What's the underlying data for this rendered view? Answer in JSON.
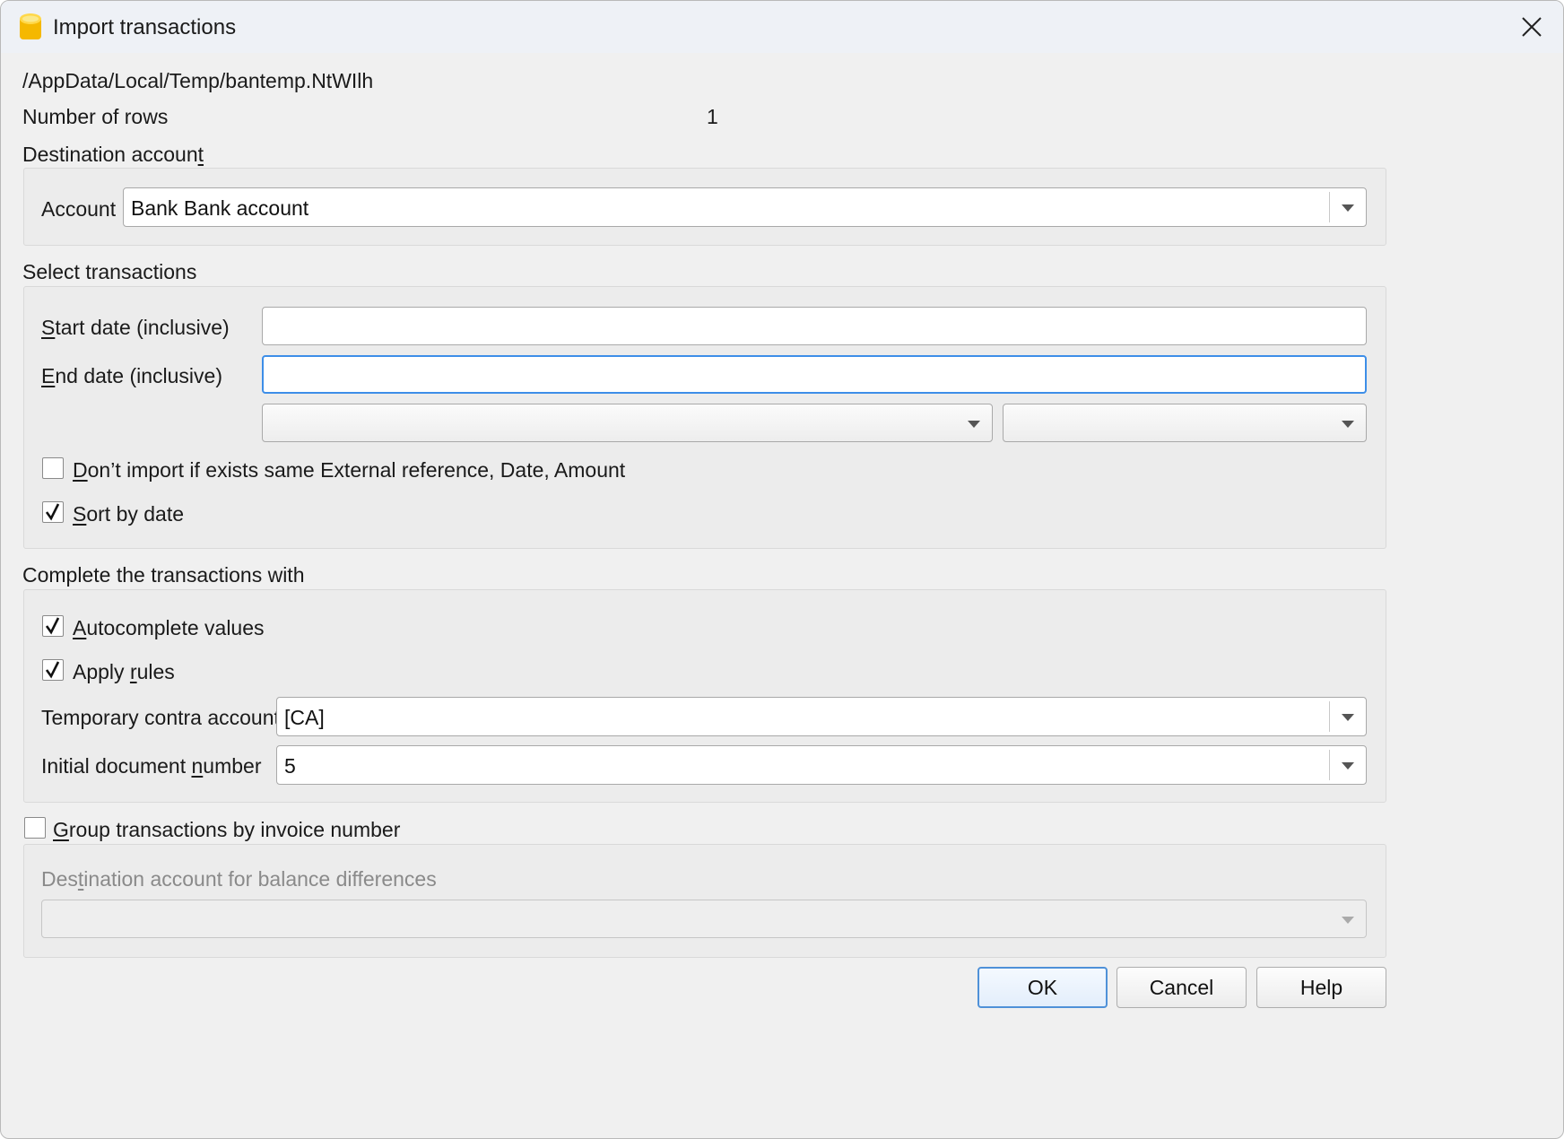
{
  "window": {
    "title": "Import transactions"
  },
  "info": {
    "file_path": "/AppData/Local/Temp/bantemp.NtWIlh",
    "rows_label": "Number of rows",
    "rows_value": "1"
  },
  "destination": {
    "section_label_pre": "Destination accoun",
    "section_label_key": "t",
    "account_label": "Account",
    "account_value": "Bank Bank account"
  },
  "select": {
    "section_label": "Select transactions",
    "start_key": "S",
    "start_rest": "tart date (inclusive)",
    "start_value": "",
    "end_key": "E",
    "end_rest": "nd date (inclusive)",
    "end_value": "",
    "combo1_value": "",
    "combo2_value": "",
    "dont_import_key": "D",
    "dont_import_rest": "on’t import if exists same External reference, Date, Amount",
    "dont_import_checked": false,
    "sort_key": "S",
    "sort_rest": "ort by date",
    "sort_checked": true
  },
  "complete": {
    "section_label": "Complete the transactions with",
    "autocomplete_key": "A",
    "autocomplete_rest": "utocomplete values",
    "autocomplete_checked": true,
    "rules_pre": "Apply ",
    "rules_key": "r",
    "rules_rest": "ules",
    "rules_checked": true,
    "contra_label": "Temporary contra account",
    "contra_value": "[CA]",
    "docnum_pre": "Initial document ",
    "docnum_key": "n",
    "docnum_rest": "umber",
    "docnum_value": "5"
  },
  "group": {
    "key": "G",
    "rest": "roup transactions by invoice number",
    "checked": false,
    "balance_pre": "Des",
    "balance_key": "t",
    "balance_rest": "ination account for balance differences",
    "balance_value": ""
  },
  "buttons": {
    "ok": "OK",
    "cancel": "Cancel",
    "help": "Help"
  },
  "icons": {
    "app": "banana-app-icon",
    "close": "close-icon",
    "check": "checkmark-icon",
    "dropdown": "chevron-down-icon"
  },
  "colors": {
    "focus_border": "#3d8ee8",
    "app_icon": "#f5c400"
  }
}
